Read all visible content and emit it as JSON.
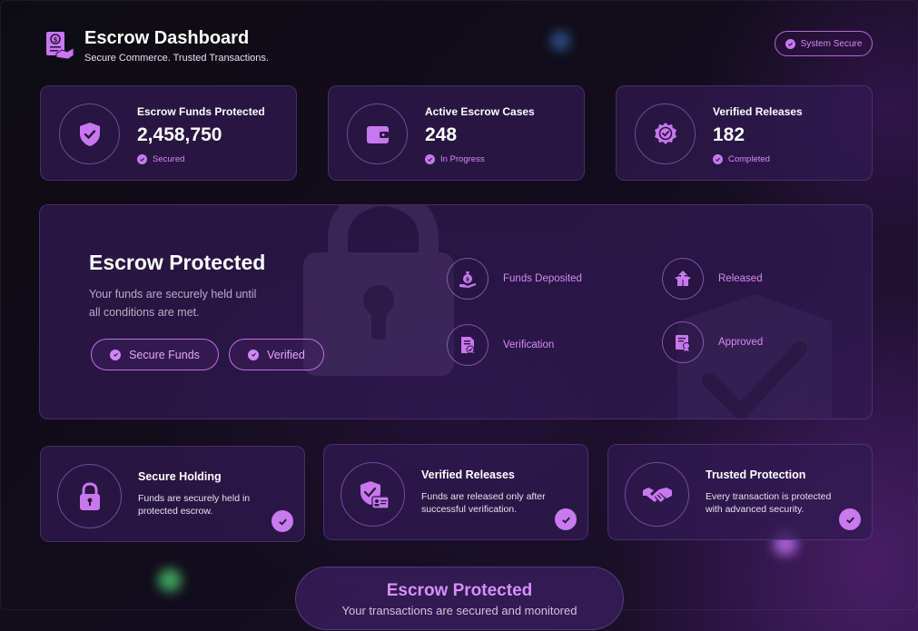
{
  "header": {
    "title": "Escrow Dashboard",
    "subtitle": "Secure Commerce. Trusted Transactions.",
    "status_pill": "System Secure"
  },
  "stats": [
    {
      "label": "Escrow Funds Protected",
      "value": "2,458,750",
      "status": "Secured",
      "icon": "shield-check-icon"
    },
    {
      "label": "Active Escrow Cases",
      "value": "248",
      "status": "In Progress",
      "icon": "wallet-icon"
    },
    {
      "label": "Verified Releases",
      "value": "182",
      "status": "Completed",
      "icon": "badge-check-icon"
    }
  ],
  "hero": {
    "title": "Escrow Protected",
    "description": "Your funds are securely held until all conditions are met.",
    "buttons": [
      "Secure Funds",
      "Verified"
    ],
    "steps": [
      {
        "label": "Funds Deposited",
        "icon": "money-bag-hand-icon"
      },
      {
        "label": "Released",
        "icon": "box-upload-icon"
      },
      {
        "label": "Verification",
        "icon": "document-check-icon"
      },
      {
        "label": "Approved",
        "icon": "certificate-icon"
      }
    ]
  },
  "features": [
    {
      "title": "Secure Holding",
      "description": "Funds are securely held in protected escrow.",
      "icon": "padlock-icon"
    },
    {
      "title": "Verified Releases",
      "description": "Funds are released only after successful verification.",
      "icon": "shield-id-card-icon"
    },
    {
      "title": "Trusted Protection",
      "description": "Every transaction is protected with advanced security.",
      "icon": "handshake-icon"
    }
  ],
  "footer": {
    "title": "Escrow Protected",
    "subtitle": "Your transactions are secured and monitored"
  },
  "colors": {
    "accent": "#c878ee",
    "card_bg": "#301a52",
    "page_bg": "#0d0b14"
  }
}
